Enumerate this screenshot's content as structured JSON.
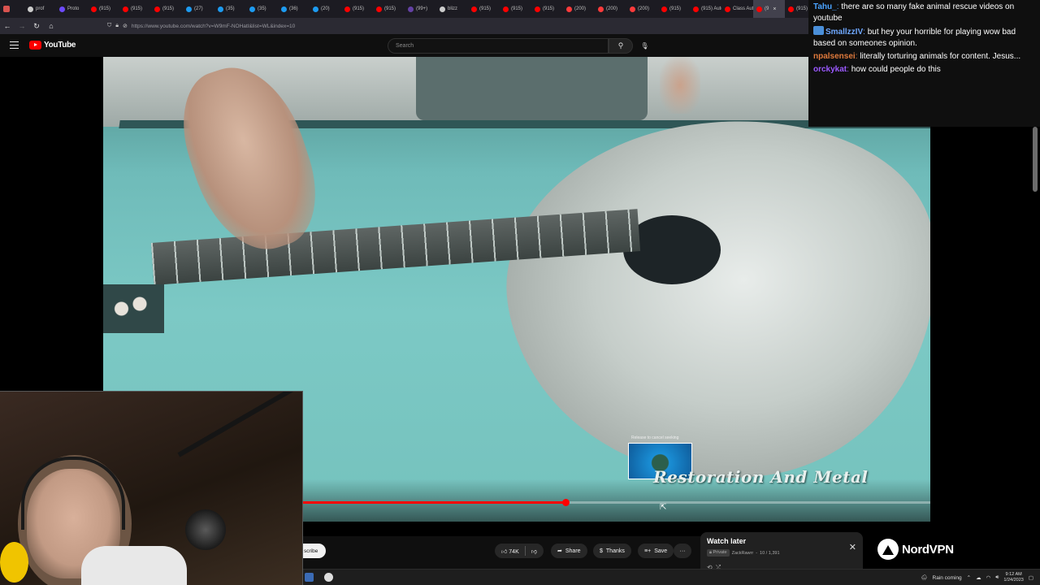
{
  "browser": {
    "tabs": [
      {
        "label": "prof",
        "color": "#cccccc"
      },
      {
        "label": "Proto",
        "color": "#6d4aff"
      },
      {
        "label": "(915)",
        "color": "#ff0000"
      },
      {
        "label": "(915)",
        "color": "#ff0000"
      },
      {
        "label": "(915)",
        "color": "#ff0000"
      },
      {
        "label": "(27)",
        "color": "#1d9bf0"
      },
      {
        "label": "(35)",
        "color": "#1d9bf0"
      },
      {
        "label": "(35)",
        "color": "#1d9bf0"
      },
      {
        "label": "(36)",
        "color": "#1d9bf0"
      },
      {
        "label": "(20)",
        "color": "#1d9bf0"
      },
      {
        "label": "(915)",
        "color": "#ff0000"
      },
      {
        "label": "(915)",
        "color": "#ff0000"
      },
      {
        "label": "(99+)",
        "color": "#6441a5"
      },
      {
        "label": "blizz",
        "color": "#cccccc"
      },
      {
        "label": "(915)",
        "color": "#ff0000"
      },
      {
        "label": "(915)",
        "color": "#ff0000"
      },
      {
        "label": "(915)",
        "color": "#ff0000"
      },
      {
        "label": "(200)",
        "color": "#ff3b3b"
      },
      {
        "label": "(200)",
        "color": "#ff3b3b"
      },
      {
        "label": "(200)",
        "color": "#ff3b3b"
      },
      {
        "label": "(915)",
        "color": "#ff0000"
      },
      {
        "label": "(915) Autom",
        "color": "#ff0000"
      },
      {
        "label": "Class Autom",
        "color": "#ff0000"
      },
      {
        "label": "(9",
        "color": "#ff0000",
        "active": true
      },
      {
        "label": "(915)",
        "color": "#ff0000"
      }
    ],
    "active_tab_close": "×",
    "url": "https://www.youtube.com/watch?v=W9mF-NOHatI&list=WL&index=10"
  },
  "youtube": {
    "logo_text": "YouTube",
    "search_placeholder": "Search"
  },
  "video": {
    "overlay_text": "Restoration And Metal",
    "preview_label": "Release to cancel seeking",
    "progress": 0.418
  },
  "chat": {
    "messages": [
      {
        "user": "Tahu_",
        "color": "#4aa3ff",
        "text": "there are so many fake animal rescue videos on youtube"
      },
      {
        "user": "SmallzzIV",
        "color": "#6fa8ff",
        "badge": true,
        "text": "but hey your horrible for playing wow bad based on someones opinion."
      },
      {
        "user": "npalsensei",
        "color": "#e07a3c",
        "text": "literally torturing animals for content. Jesus..."
      },
      {
        "user": "orckykat",
        "color": "#9b59ff",
        "text": "how could people do this"
      }
    ]
  },
  "actions": {
    "subscribe": "scribe",
    "likes": "74K",
    "share": "Share",
    "thanks": "Thanks",
    "save": "Save",
    "more": "···"
  },
  "watch_later": {
    "title": "Watch later",
    "privacy": "Private",
    "owner": "ZackRawrr",
    "position": "10 / 1,391"
  },
  "sponsor": {
    "name": "NordVPN"
  },
  "taskbar": {
    "weather": "Rain coming",
    "time": "9:12 AM",
    "date": "1/24/2023"
  }
}
